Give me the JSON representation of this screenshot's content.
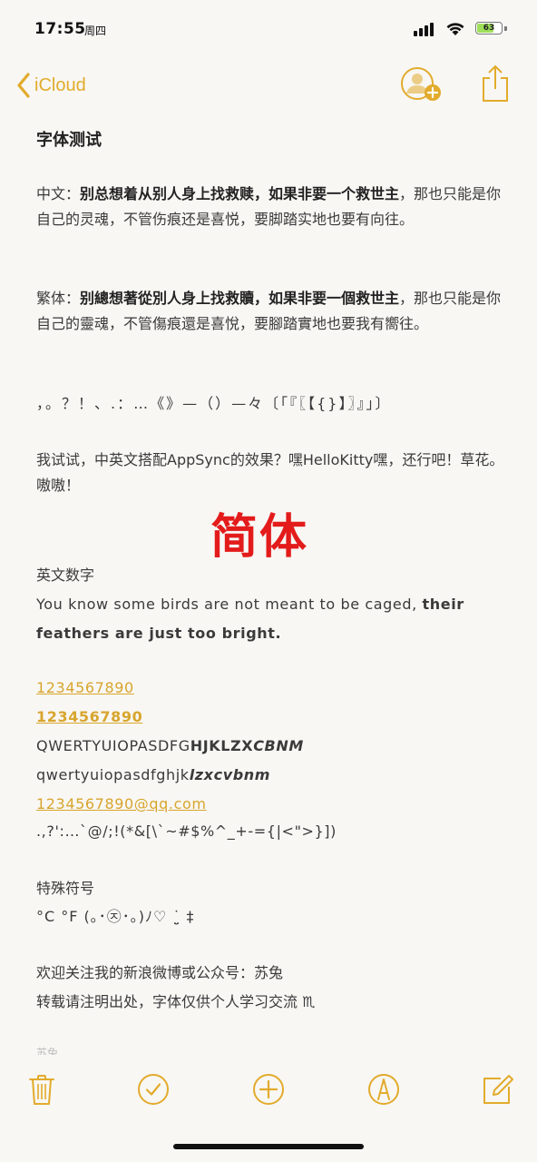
{
  "status": {
    "time": "17:55",
    "day": "周四",
    "battery": "63",
    "battery_level": 0.63,
    "icons": [
      "signal-icon",
      "wifi-icon",
      "battery-icon"
    ]
  },
  "nav": {
    "back_label": "iCloud",
    "accent_color": "#e2ab2c",
    "icons": [
      "chevron-left-icon",
      "add-people-icon",
      "share-icon"
    ]
  },
  "note": {
    "title": "字体测试",
    "p1_prefix": "中文：",
    "p1_bold": "别总想着从别人身上找救赎，如果非要一个救世主",
    "p1_rest": "，那也只能是你自己的灵魂，不管伤痕还是喜悦，要脚踏实地也要有向往。",
    "p2_prefix": "繁体：",
    "p2_bold": "别總想著從別人身上找救贖，如果非要一個救世主",
    "p2_rest": "，那也只能是你自己的靈魂，不管傷痕還是喜悅，要腳踏實地也要我有嚮往。",
    "punct": "，。？！、.：…《》—（）—々〔「『〖【{}】〗』」〕",
    "mixed": "我试试，中英文搭配AppSync的效果？嘿HelloKitty嘿，还行吧！草花。嗷嗷！",
    "watermark": "简体",
    "en_heading": "英文数字",
    "en_plain": "You know some birds are not meant to be caged, ",
    "en_bold": "their feathers are just too bright.",
    "num_link1": "1234567890",
    "num_link2": "1234567890",
    "qwerty_plain": "QWERTYUIOPASDFG",
    "qwerty_bold": "HJKLZX",
    "qwerty_italic": "CBNM",
    "lower_plain": "qwertyuiopasdfghjk",
    "lower_italic": "lzxcvbnm",
    "email": "1234567890@qq.com",
    "symbols": ".,?':…`@/;!(*&[\\`~#$%^_+-={|<\">}])",
    "special_heading": "特殊符号",
    "special_chars": "°C  °F  (｡･㉨･｡)ﾉ♡  ˙̤̮ ‡",
    "follow": "欢迎关注我的新浪微博或公众号：苏兔",
    "notice": "转载请注明出处，字体仅供个人学习交流 ♏︎",
    "cut_off": "苏兔"
  },
  "toolbar": {
    "icons": [
      "trash-icon",
      "checklist-icon",
      "add-icon",
      "markup-icon",
      "compose-icon"
    ]
  }
}
